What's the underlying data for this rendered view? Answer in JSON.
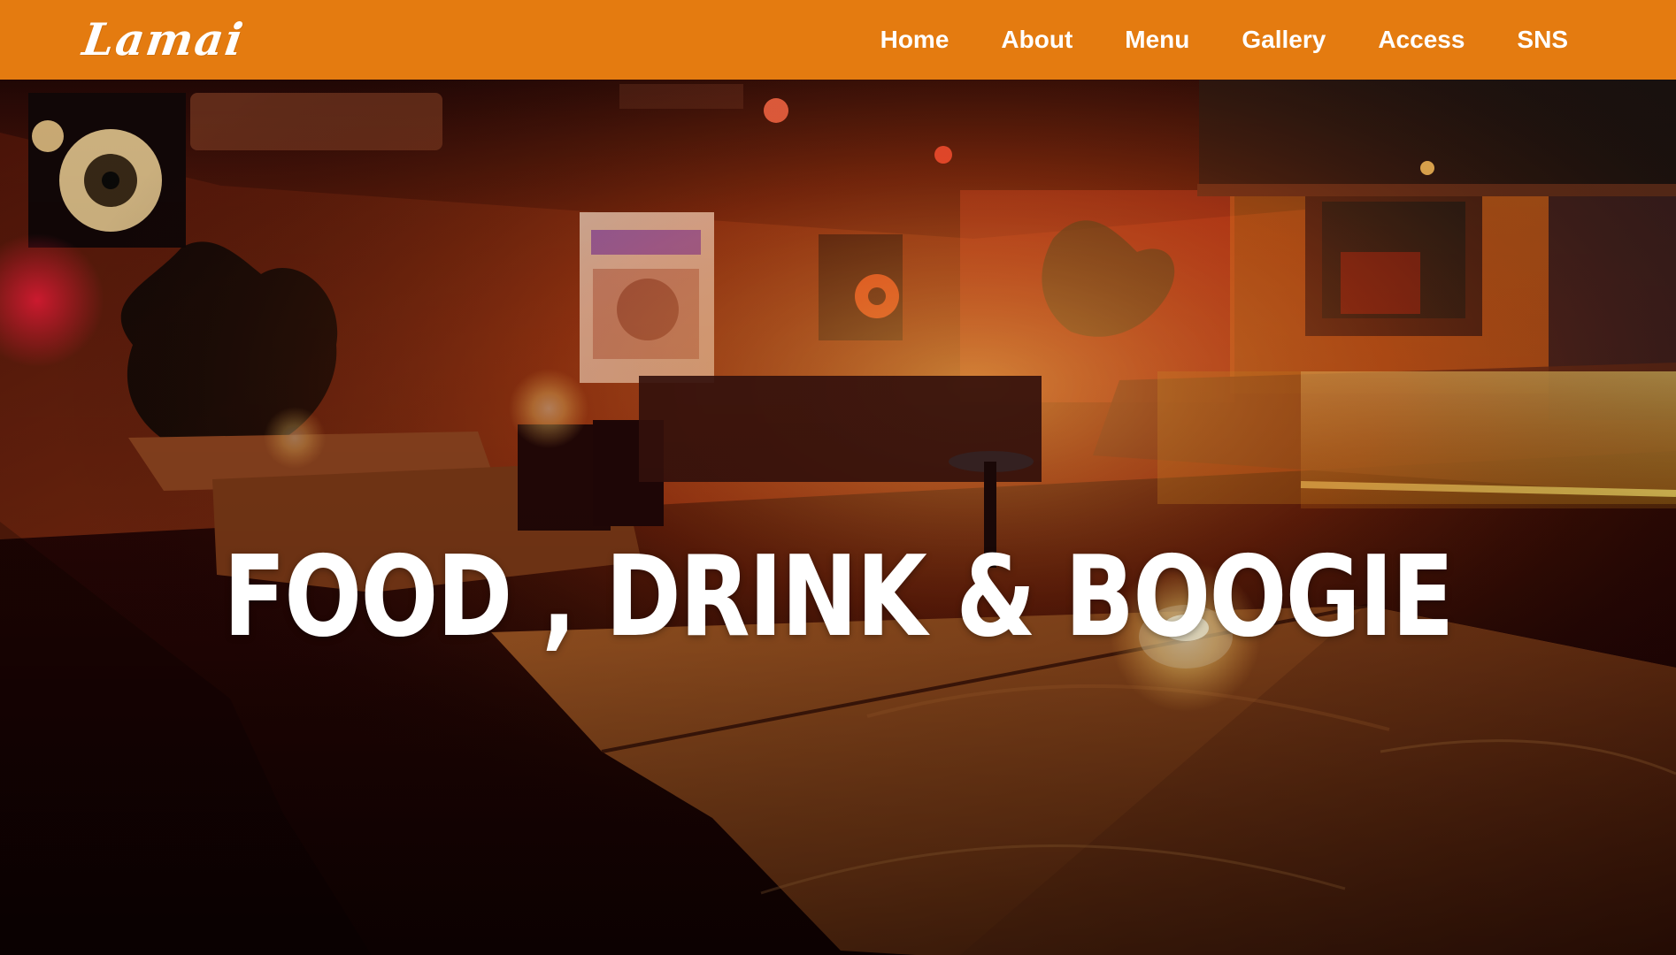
{
  "header": {
    "logo_text": "Lamai",
    "nav": [
      {
        "label": "Home"
      },
      {
        "label": "About"
      },
      {
        "label": "Menu"
      },
      {
        "label": "Gallery"
      },
      {
        "label": "Access"
      },
      {
        "label": "SNS"
      }
    ]
  },
  "hero": {
    "headline": "FOOD , DRINK & BOOGIE",
    "image_description": "Dimly lit bar interior with wooden tables, candles, speakers, plants and a glowing counter"
  },
  "colors": {
    "header_bg": "#e47b10",
    "nav_text": "#ffffff",
    "headline_text": "#ffffff"
  }
}
